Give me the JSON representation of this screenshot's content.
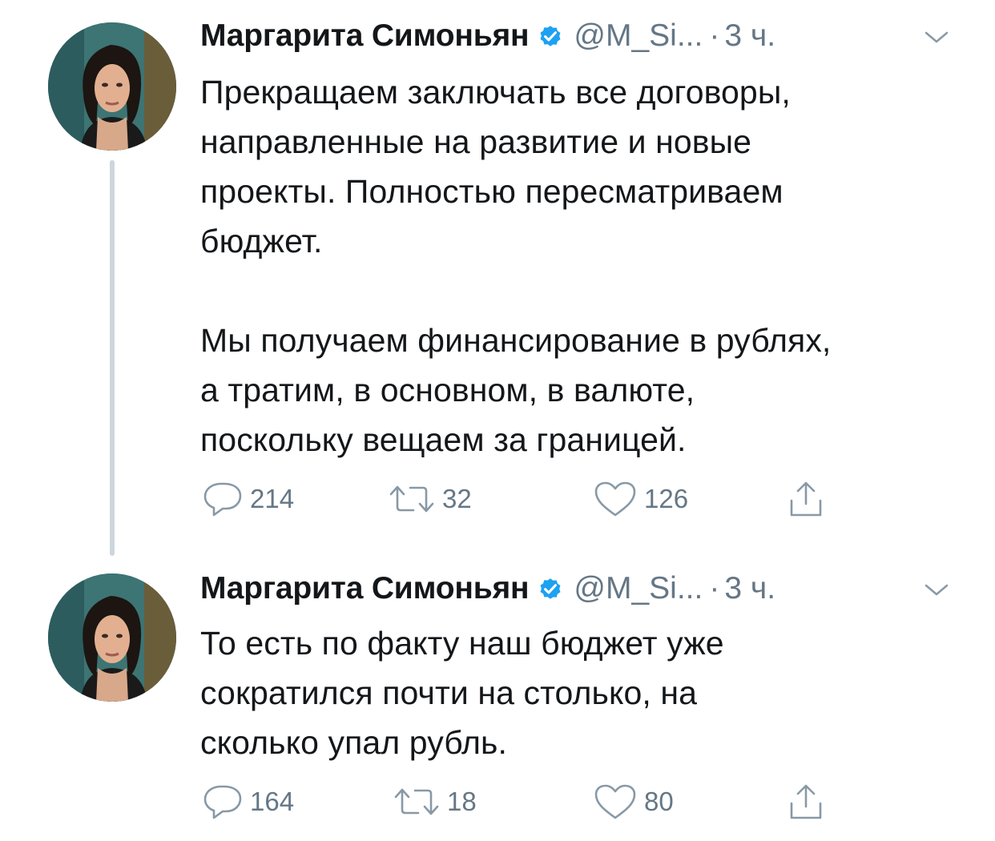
{
  "tweets": [
    {
      "author_name": "Маргарита Симоньян",
      "handle": "@M_Si...",
      "dot": "·",
      "time": "3 ч.",
      "text": "Прекращаем заключать все договоры,\nнаправленные на развитие и новые\nпроекты. Полностью пересматриваем\nбюджет.\n\nМы получаем финансирование в рублях,\nа тратим, в основном, в валюте,\nпоскольку вещаем за границей.",
      "replies": "214",
      "retweets": "32",
      "likes": "126"
    },
    {
      "author_name": "Маргарита Симоньян",
      "handle": "@M_Si...",
      "dot": "·",
      "time": "3 ч.",
      "text": "То есть по факту наш бюджет уже\nсократился почти на столько, на\nсколько упал рубль.",
      "replies": "164",
      "retweets": "18",
      "likes": "80"
    }
  ],
  "colors": {
    "text": "#14171a",
    "secondary": "#657786",
    "verified": "#1da1f2",
    "thread_line": "#ccd6dd"
  },
  "icons": {
    "verified": "verified-badge-icon",
    "caret": "chevron-down-icon",
    "reply": "reply-icon",
    "retweet": "retweet-icon",
    "like": "heart-icon",
    "share": "share-icon"
  }
}
